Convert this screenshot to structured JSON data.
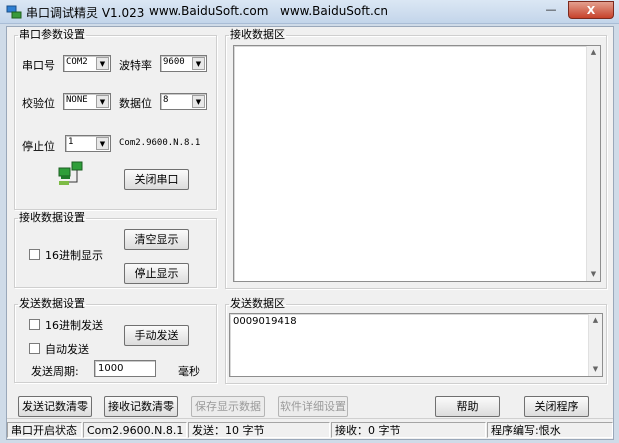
{
  "window": {
    "title": "串口调试精灵 V1.023",
    "site1": "www.BaiduSoft.com",
    "site2": "www.BaiduSoft.cn",
    "min_symbol": "—",
    "close_symbol": "X"
  },
  "port_settings": {
    "legend": "串口参数设置",
    "port_label": "串口号",
    "port_value": "COM2",
    "baud_label": "波特率",
    "baud_value": "9600",
    "parity_label": "校验位",
    "parity_value": "NONE",
    "databits_label": "数据位",
    "databits_value": "8",
    "stopbits_label": "停止位",
    "stopbits_value": "1",
    "config_summary": "Com2.9600.N.8.1",
    "close_port_button": "关闭串口"
  },
  "receive_settings": {
    "legend": "接收数据设置",
    "hex_display_label": "16进制显示",
    "clear_button": "清空显示",
    "stop_button": "停止显示"
  },
  "send_settings": {
    "legend": "发送数据设置",
    "hex_send_label": "16进制发送",
    "auto_send_label": "自动发送",
    "manual_send_button": "手动发送",
    "period_label": "发送周期:",
    "period_value": "1000",
    "period_unit": "毫秒"
  },
  "receive_area": {
    "legend": "接收数据区",
    "content": ""
  },
  "send_area": {
    "legend": "发送数据区",
    "content": "0009019418"
  },
  "bottom_buttons": {
    "clear_send_count": "发送记数清零",
    "clear_recv_count": "接收记数清零",
    "save_display": "保存显示数据",
    "detail_settings": "软件详细设置",
    "help": "帮助",
    "close_program": "关闭程序"
  },
  "status": {
    "port_state": "串口开启状态",
    "port_config": "Com2.9600.N.8.1",
    "sent": "发送：10 字节",
    "received": "接收：0 字节",
    "author": "程序编写:恨水"
  }
}
